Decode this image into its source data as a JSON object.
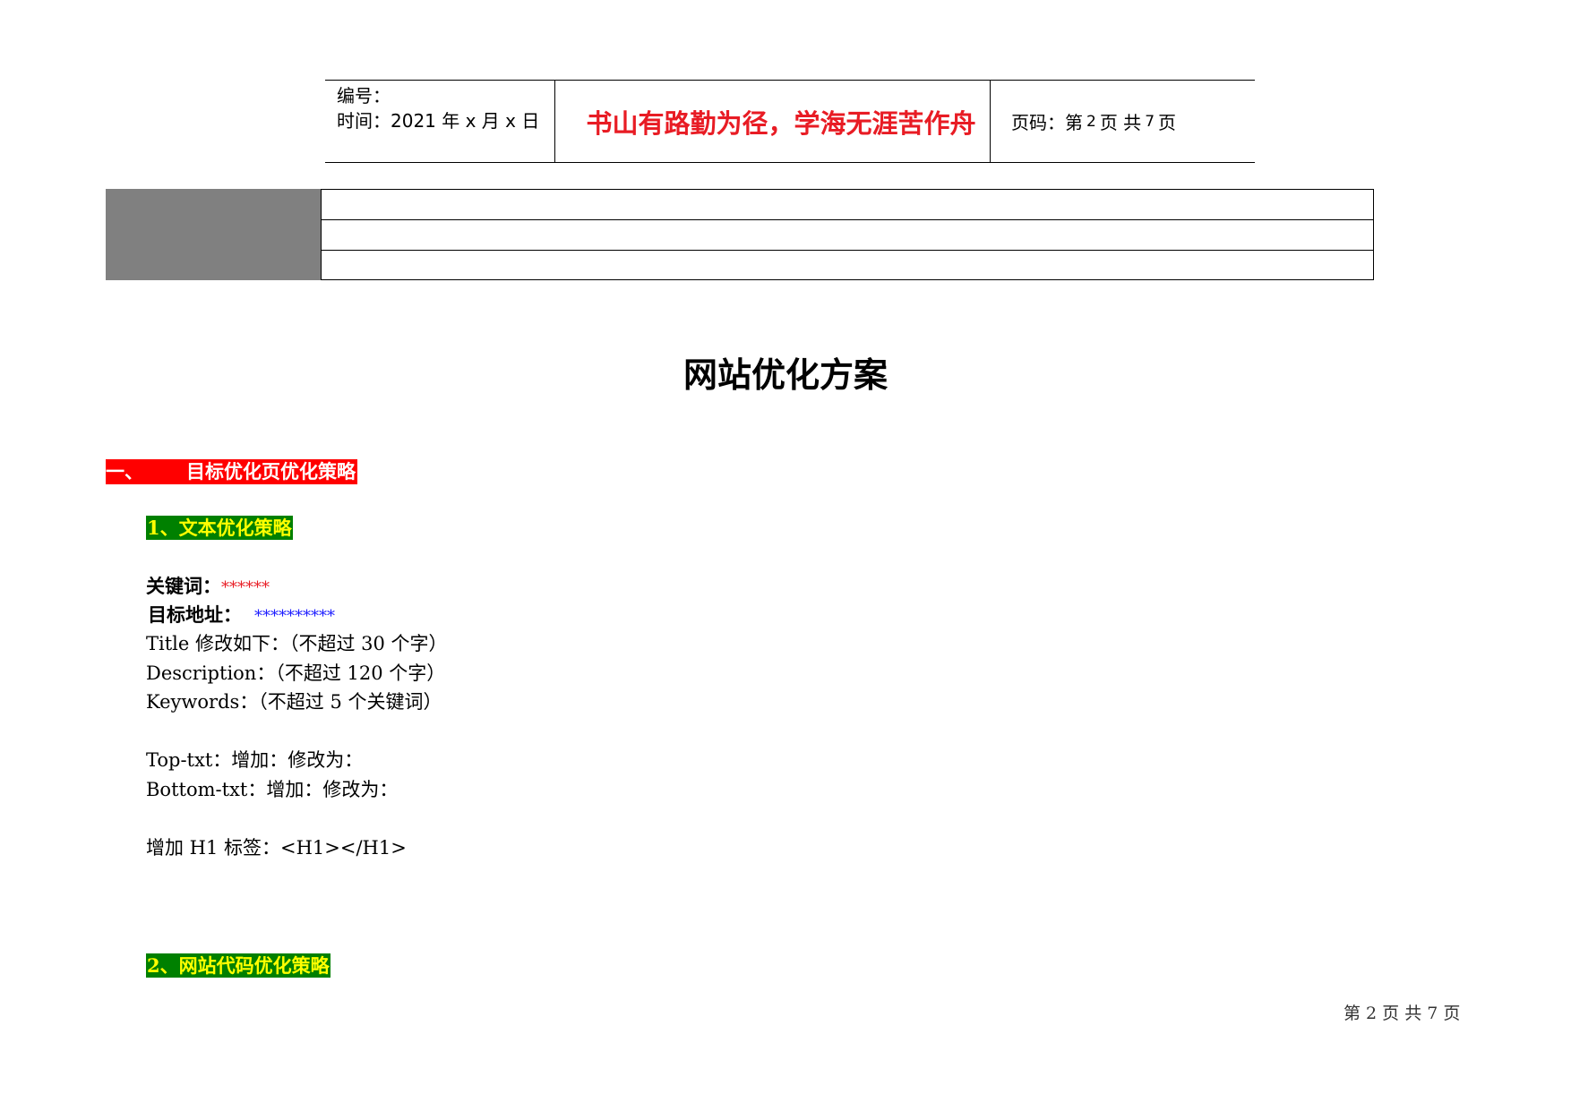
{
  "header": {
    "number_label": "编号：",
    "date_label": "时间：2021 年 x 月 x 日",
    "motto": "书山有路勤为径，学海无涯苦作舟",
    "page_prefix": "页码：第",
    "page_current": "2",
    "page_mid": "页  共",
    "page_total": "7",
    "page_suffix": "页"
  },
  "title": "网站优化方案",
  "section1": {
    "number": "一、",
    "label": "目标优化页优化策略"
  },
  "sub1": "1、文本优化策略",
  "keyword_label": "关键词：",
  "keyword_value": "******",
  "target_label": "目标地址：",
  "target_value": "**********",
  "title_line": "Title 修改如下：（不超过 30 个字）",
  "description_line": "Description：（不超过 120 个字）",
  "keywords_line": "Keywords：（不超过 5 个关键词）",
  "top_txt_line": "Top-txt：增加：修改为：",
  "bottom_txt_line": "Bottom-txt：增加：修改为：",
  "h1_line": "增加 H1 标签：<H1></H1>",
  "sub2": "2、网站代码优化策略",
  "footer": "第 2 页 共 7 页"
}
